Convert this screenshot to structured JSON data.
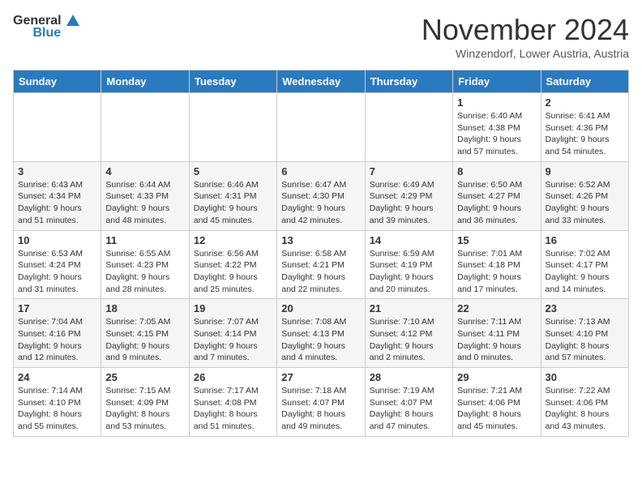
{
  "header": {
    "logo_general": "General",
    "logo_blue": "Blue",
    "month_title": "November 2024",
    "location": "Winzendorf, Lower Austria, Austria"
  },
  "weekdays": [
    "Sunday",
    "Monday",
    "Tuesday",
    "Wednesday",
    "Thursday",
    "Friday",
    "Saturday"
  ],
  "weeks": [
    [
      {
        "day": "",
        "detail": ""
      },
      {
        "day": "",
        "detail": ""
      },
      {
        "day": "",
        "detail": ""
      },
      {
        "day": "",
        "detail": ""
      },
      {
        "day": "",
        "detail": ""
      },
      {
        "day": "1",
        "detail": "Sunrise: 6:40 AM\nSunset: 4:38 PM\nDaylight: 9 hours\nand 57 minutes."
      },
      {
        "day": "2",
        "detail": "Sunrise: 6:41 AM\nSunset: 4:36 PM\nDaylight: 9 hours\nand 54 minutes."
      }
    ],
    [
      {
        "day": "3",
        "detail": "Sunrise: 6:43 AM\nSunset: 4:34 PM\nDaylight: 9 hours\nand 51 minutes."
      },
      {
        "day": "4",
        "detail": "Sunrise: 6:44 AM\nSunset: 4:33 PM\nDaylight: 9 hours\nand 48 minutes."
      },
      {
        "day": "5",
        "detail": "Sunrise: 6:46 AM\nSunset: 4:31 PM\nDaylight: 9 hours\nand 45 minutes."
      },
      {
        "day": "6",
        "detail": "Sunrise: 6:47 AM\nSunset: 4:30 PM\nDaylight: 9 hours\nand 42 minutes."
      },
      {
        "day": "7",
        "detail": "Sunrise: 6:49 AM\nSunset: 4:29 PM\nDaylight: 9 hours\nand 39 minutes."
      },
      {
        "day": "8",
        "detail": "Sunrise: 6:50 AM\nSunset: 4:27 PM\nDaylight: 9 hours\nand 36 minutes."
      },
      {
        "day": "9",
        "detail": "Sunrise: 6:52 AM\nSunset: 4:26 PM\nDaylight: 9 hours\nand 33 minutes."
      }
    ],
    [
      {
        "day": "10",
        "detail": "Sunrise: 6:53 AM\nSunset: 4:24 PM\nDaylight: 9 hours\nand 31 minutes."
      },
      {
        "day": "11",
        "detail": "Sunrise: 6:55 AM\nSunset: 4:23 PM\nDaylight: 9 hours\nand 28 minutes."
      },
      {
        "day": "12",
        "detail": "Sunrise: 6:56 AM\nSunset: 4:22 PM\nDaylight: 9 hours\nand 25 minutes."
      },
      {
        "day": "13",
        "detail": "Sunrise: 6:58 AM\nSunset: 4:21 PM\nDaylight: 9 hours\nand 22 minutes."
      },
      {
        "day": "14",
        "detail": "Sunrise: 6:59 AM\nSunset: 4:19 PM\nDaylight: 9 hours\nand 20 minutes."
      },
      {
        "day": "15",
        "detail": "Sunrise: 7:01 AM\nSunset: 4:18 PM\nDaylight: 9 hours\nand 17 minutes."
      },
      {
        "day": "16",
        "detail": "Sunrise: 7:02 AM\nSunset: 4:17 PM\nDaylight: 9 hours\nand 14 minutes."
      }
    ],
    [
      {
        "day": "17",
        "detail": "Sunrise: 7:04 AM\nSunset: 4:16 PM\nDaylight: 9 hours\nand 12 minutes."
      },
      {
        "day": "18",
        "detail": "Sunrise: 7:05 AM\nSunset: 4:15 PM\nDaylight: 9 hours\nand 9 minutes."
      },
      {
        "day": "19",
        "detail": "Sunrise: 7:07 AM\nSunset: 4:14 PM\nDaylight: 9 hours\nand 7 minutes."
      },
      {
        "day": "20",
        "detail": "Sunrise: 7:08 AM\nSunset: 4:13 PM\nDaylight: 9 hours\nand 4 minutes."
      },
      {
        "day": "21",
        "detail": "Sunrise: 7:10 AM\nSunset: 4:12 PM\nDaylight: 9 hours\nand 2 minutes."
      },
      {
        "day": "22",
        "detail": "Sunrise: 7:11 AM\nSunset: 4:11 PM\nDaylight: 9 hours\nand 0 minutes."
      },
      {
        "day": "23",
        "detail": "Sunrise: 7:13 AM\nSunset: 4:10 PM\nDaylight: 8 hours\nand 57 minutes."
      }
    ],
    [
      {
        "day": "24",
        "detail": "Sunrise: 7:14 AM\nSunset: 4:10 PM\nDaylight: 8 hours\nand 55 minutes."
      },
      {
        "day": "25",
        "detail": "Sunrise: 7:15 AM\nSunset: 4:09 PM\nDaylight: 8 hours\nand 53 minutes."
      },
      {
        "day": "26",
        "detail": "Sunrise: 7:17 AM\nSunset: 4:08 PM\nDaylight: 8 hours\nand 51 minutes."
      },
      {
        "day": "27",
        "detail": "Sunrise: 7:18 AM\nSunset: 4:07 PM\nDaylight: 8 hours\nand 49 minutes."
      },
      {
        "day": "28",
        "detail": "Sunrise: 7:19 AM\nSunset: 4:07 PM\nDaylight: 8 hours\nand 47 minutes."
      },
      {
        "day": "29",
        "detail": "Sunrise: 7:21 AM\nSunset: 4:06 PM\nDaylight: 8 hours\nand 45 minutes."
      },
      {
        "day": "30",
        "detail": "Sunrise: 7:22 AM\nSunset: 4:06 PM\nDaylight: 8 hours\nand 43 minutes."
      }
    ]
  ]
}
